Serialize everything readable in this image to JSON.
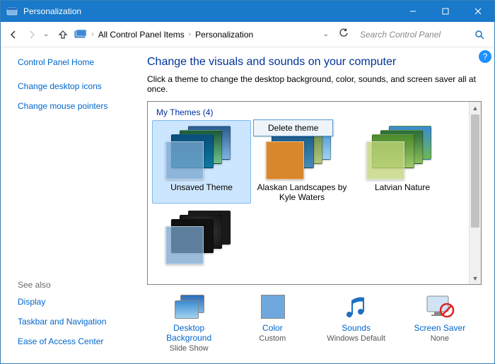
{
  "window": {
    "title": "Personalization"
  },
  "breadcrumb": {
    "item1": "All Control Panel Items",
    "item2": "Personalization"
  },
  "search": {
    "placeholder": "Search Control Panel"
  },
  "sidebar": {
    "home": "Control Panel Home",
    "links": {
      "0": "Change desktop icons",
      "1": "Change mouse pointers"
    },
    "seealso_label": "See also",
    "seealso": {
      "0": "Display",
      "1": "Taskbar and Navigation",
      "2": "Ease of Access Center"
    }
  },
  "main": {
    "title": "Change the visuals and sounds on your computer",
    "subtitle": "Click a theme to change the desktop background, color, sounds, and screen saver all at once.",
    "themes_header": "My Themes (4)",
    "themes": {
      "0": {
        "label": "Unsaved Theme"
      },
      "1": {
        "label": "Alaskan Landscapes by Kyle Waters"
      },
      "2": {
        "label": "Latvian Nature"
      },
      "3": {
        "label": ""
      }
    },
    "context_menu": {
      "delete": "Delete theme"
    }
  },
  "bottom": {
    "0": {
      "label": "Desktop Background",
      "sub": "Slide Show"
    },
    "1": {
      "label": "Color",
      "sub": "Custom"
    },
    "2": {
      "label": "Sounds",
      "sub": "Windows Default"
    },
    "3": {
      "label": "Screen Saver",
      "sub": "None"
    }
  }
}
